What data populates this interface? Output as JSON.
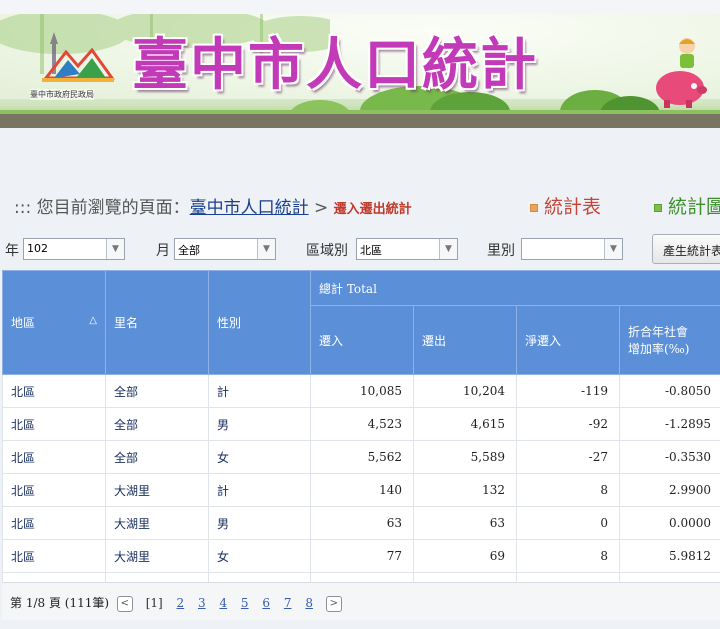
{
  "banner": {
    "title": "臺中市人口統計",
    "org": "臺中市政府民政局"
  },
  "breadcrumb": {
    "prefix": "::: 您目前瀏覽的頁面：",
    "home": "臺中市人口統計",
    "sep": ">",
    "current": "遷入遷出統計"
  },
  "nav": {
    "table_link": "統計表",
    "chart_link": "統計圖"
  },
  "filters": {
    "year_label": "年",
    "year_value": "102",
    "month_label": "月",
    "month_value": "全部",
    "district_label": "區域別",
    "district_value": "北區",
    "village_label": "里別",
    "village_value": "",
    "generate_button": "產生統計表"
  },
  "table": {
    "headers": {
      "district": "地區",
      "village": "里名",
      "gender": "性別",
      "group_total": "總計 Total",
      "move_in": "遷入",
      "move_out": "遷出",
      "net_in": "淨遷入",
      "rate_line1": "折合年社會",
      "rate_line2": "增加率(‰)"
    },
    "rows": [
      {
        "district": "北區",
        "village": "全部",
        "gender": "計",
        "move_in": "10,085",
        "move_out": "10,204",
        "net": "-119",
        "rate": "-0.8050"
      },
      {
        "district": "北區",
        "village": "全部",
        "gender": "男",
        "move_in": "4,523",
        "move_out": "4,615",
        "net": "-92",
        "rate": "-1.2895"
      },
      {
        "district": "北區",
        "village": "全部",
        "gender": "女",
        "move_in": "5,562",
        "move_out": "5,589",
        "net": "-27",
        "rate": "-0.3530"
      },
      {
        "district": "北區",
        "village": "大湖里",
        "gender": "計",
        "move_in": "140",
        "move_out": "132",
        "net": "8",
        "rate": "2.9900"
      },
      {
        "district": "北區",
        "village": "大湖里",
        "gender": "男",
        "move_in": "63",
        "move_out": "63",
        "net": "0",
        "rate": "0.0000"
      },
      {
        "district": "北區",
        "village": "大湖里",
        "gender": "女",
        "move_in": "77",
        "move_out": "69",
        "net": "8",
        "rate": "5.9812"
      }
    ]
  },
  "pager": {
    "summary": "第 1/8 頁 (111筆)",
    "prev": "<",
    "next": ">",
    "current_page": "[1]",
    "pages": [
      "2",
      "3",
      "4",
      "5",
      "6",
      "7",
      "8"
    ]
  }
}
